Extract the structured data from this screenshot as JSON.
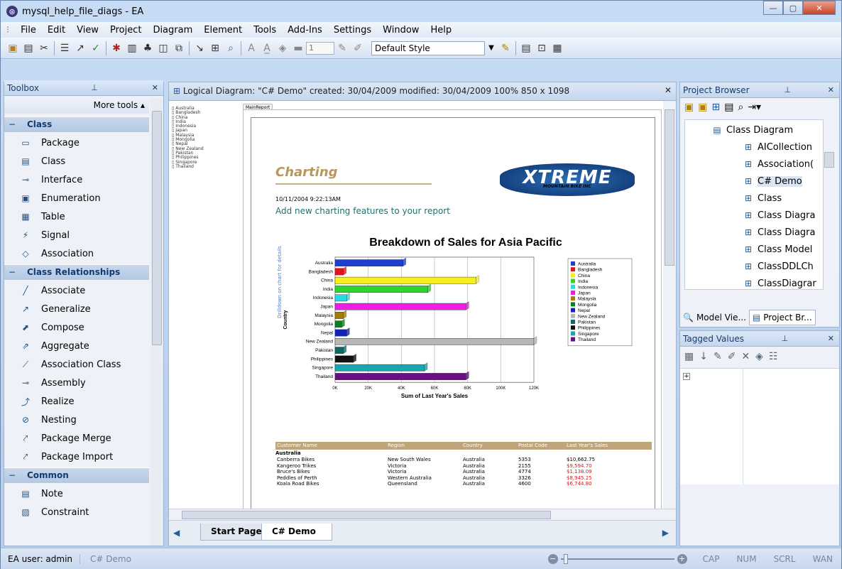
{
  "window": {
    "title": "mysql_help_file_diags - EA"
  },
  "menu": [
    "File",
    "Edit",
    "View",
    "Project",
    "Diagram",
    "Element",
    "Tools",
    "Add-Ins",
    "Settings",
    "Window",
    "Help"
  ],
  "toolbar": {
    "style_select": "Default Style",
    "line_width": "1"
  },
  "toolbox": {
    "title": "Toolbox",
    "more_tools": "More tools",
    "sections": [
      {
        "name": "Class",
        "items": [
          {
            "label": "Package",
            "icon": "package-icon"
          },
          {
            "label": "Class",
            "icon": "class-icon"
          },
          {
            "label": "Interface",
            "icon": "interface-icon"
          },
          {
            "label": "Enumeration",
            "icon": "enumeration-icon"
          },
          {
            "label": "Table",
            "icon": "table-icon"
          },
          {
            "label": "Signal",
            "icon": "signal-icon"
          },
          {
            "label": "Association",
            "icon": "association-icon"
          }
        ]
      },
      {
        "name": "Class Relationships",
        "items": [
          {
            "label": "Associate",
            "icon": "associate-icon"
          },
          {
            "label": "Generalize",
            "icon": "generalize-icon"
          },
          {
            "label": "Compose",
            "icon": "compose-icon"
          },
          {
            "label": "Aggregate",
            "icon": "aggregate-icon"
          },
          {
            "label": "Association Class",
            "icon": "association-class-icon"
          },
          {
            "label": "Assembly",
            "icon": "assembly-icon"
          },
          {
            "label": "Realize",
            "icon": "realize-icon"
          },
          {
            "label": "Nesting",
            "icon": "nesting-icon"
          },
          {
            "label": "Package Merge",
            "icon": "package-merge-icon"
          },
          {
            "label": "Package Import",
            "icon": "package-import-icon"
          }
        ]
      },
      {
        "name": "Common",
        "items": [
          {
            "label": "Note",
            "icon": "note-icon"
          },
          {
            "label": "Constraint",
            "icon": "constraint-icon"
          }
        ]
      }
    ]
  },
  "diagram": {
    "header": "Logical Diagram: \"C# Demo\"   created: 30/04/2009  modified: 30/04/2009   100%   850 x 1098",
    "mini_tree": [
      "Australia",
      "Bangladesh",
      "China",
      "India",
      "Indonesia",
      "Japan",
      "Malaysia",
      "Mongolia",
      "Nepal",
      "New Zealand",
      "Pakistan",
      "Philippines",
      "Singapore",
      "Thailand"
    ],
    "main_report_tab": "MainReport",
    "report": {
      "heading": "Charting",
      "logo": "XTREME",
      "logo_sub": "MOUNTAIN BIKE INC",
      "timestamp": "10/11/2004   9:22:13AM",
      "subtitle": "Add new charting features to your report",
      "side_label": "Drilldown on chart for details",
      "table_headers": [
        "Customer Name",
        "Region",
        "Country",
        "Postal Code",
        "Last Year's Sales"
      ],
      "group": "Australia",
      "rows": [
        [
          "Canberra Bikes",
          "New South Wales",
          "Australia",
          "5353",
          "$10,662.75"
        ],
        [
          "Kangeroo Trikes",
          "Victoria",
          "Australia",
          "2155",
          "$9,594.70"
        ],
        [
          "Bruce's Bikes",
          "Victoria",
          "Australia",
          "4774",
          "$1,138.09"
        ],
        [
          "Peddles of Perth",
          "Western Australia",
          "Australia",
          "3326",
          "$8,945.25"
        ],
        [
          "Koala Road Bikes",
          "Queensland",
          "Australia",
          "4600",
          "$6,744.80"
        ]
      ]
    },
    "tabs": {
      "start": "Start Page",
      "active": "C# Demo"
    }
  },
  "chart_data": {
    "type": "bar",
    "title": "Breakdown of Sales for Asia Pacific",
    "xlabel": "Sum of Last Year's Sales",
    "ylabel": "Country",
    "orientation": "horizontal",
    "xlim": [
      0,
      120000
    ],
    "x_ticks": [
      "0K",
      "20K",
      "40K",
      "60K",
      "80K",
      "100K",
      "120K"
    ],
    "legend": "right",
    "categories": [
      "Australia",
      "Bangladesh",
      "China",
      "India",
      "Indonesia",
      "Japan",
      "Malaysia",
      "Mongolia",
      "Nepal",
      "New Zealand",
      "Pakistan",
      "Philippines",
      "Singapore",
      "Thailand"
    ],
    "values": [
      41000,
      5000,
      85000,
      56000,
      7000,
      79000,
      5000,
      4000,
      7000,
      124000,
      5000,
      11000,
      54000,
      79000
    ],
    "colors": [
      "#1e3fd0",
      "#e0161b",
      "#f6ee1e",
      "#2fd42f",
      "#27dbe5",
      "#ee1de5",
      "#a67c08",
      "#0c7f23",
      "#1522b8",
      "#b7b7b7",
      "#0a6a6a",
      "#111111",
      "#15a8ae",
      "#6b0d86"
    ]
  },
  "project_browser": {
    "title": "Project Browser",
    "tree": [
      {
        "label": "Class Diagram",
        "indent": 0,
        "icon": "package-icon"
      },
      {
        "label": "AICollection",
        "indent": 1,
        "icon": "diagram-icon"
      },
      {
        "label": "Association(",
        "indent": 1,
        "icon": "diagram-icon"
      },
      {
        "label": "C# Demo",
        "indent": 1,
        "icon": "diagram-icon"
      },
      {
        "label": "Class",
        "indent": 1,
        "icon": "diagram-icon"
      },
      {
        "label": "Class Diagra",
        "indent": 1,
        "icon": "diagram-icon"
      },
      {
        "label": "Class Diagra",
        "indent": 1,
        "icon": "diagram-icon"
      },
      {
        "label": "Class Model",
        "indent": 1,
        "icon": "diagram-icon"
      },
      {
        "label": "ClassDDLCh",
        "indent": 1,
        "icon": "diagram-icon"
      },
      {
        "label": "ClassDiagrar",
        "indent": 1,
        "icon": "diagram-icon"
      }
    ],
    "tabs": [
      "Model Vie...",
      "Project Br..."
    ]
  },
  "tagged_values": {
    "title": "Tagged Values"
  },
  "status": {
    "user": "EA user: admin",
    "diagram": "C# Demo",
    "indicators": [
      "CAP",
      "NUM",
      "SCRL",
      "WAN"
    ]
  }
}
